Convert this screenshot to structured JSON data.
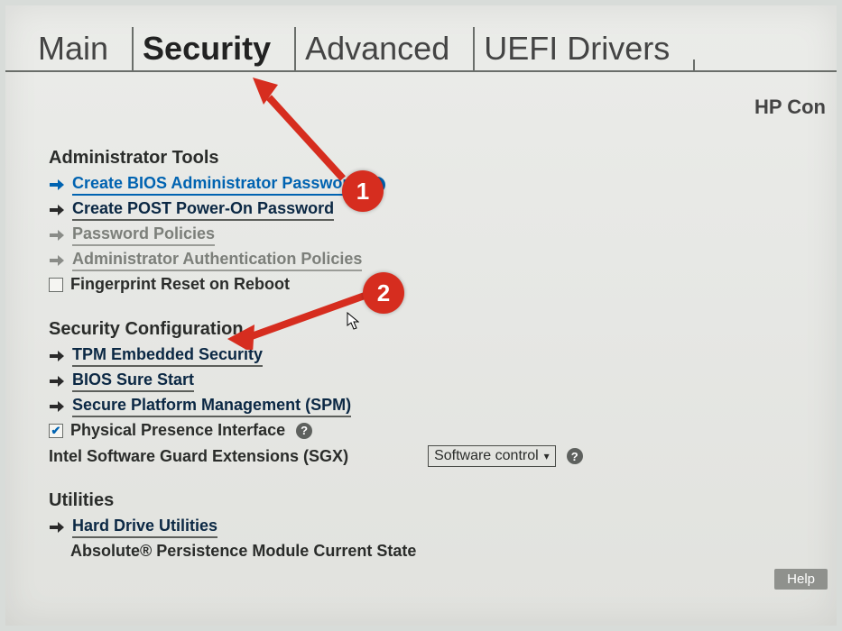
{
  "brand": "HP Con",
  "tabs": {
    "main": "Main",
    "security": "Security",
    "advanced": "Advanced",
    "uefi": "UEFI Drivers"
  },
  "admin_tools": {
    "title": "Administrator Tools",
    "create_bios_pw": "Create BIOS Administrator Password",
    "create_post_pw": "Create POST Power-On Password",
    "pw_policies": "Password Policies",
    "admin_auth_policies": "Administrator Authentication Policies",
    "fingerprint_reset": "Fingerprint Reset on Reboot"
  },
  "sec_config": {
    "title": "Security Configuration",
    "tpm": "TPM Embedded Security",
    "sure_start": "BIOS Sure Start",
    "spm": "Secure Platform Management (SPM)",
    "ppi": "Physical Presence Interface",
    "sgx_label": "Intel Software Guard Extensions (SGX)",
    "sgx_value": "Software control"
  },
  "utilities": {
    "title": "Utilities",
    "hdd": "Hard Drive Utilities",
    "absolute": "Absolute® Persistence Module Current State"
  },
  "help_button": "Help",
  "annotations": {
    "one": "1",
    "two": "2"
  }
}
